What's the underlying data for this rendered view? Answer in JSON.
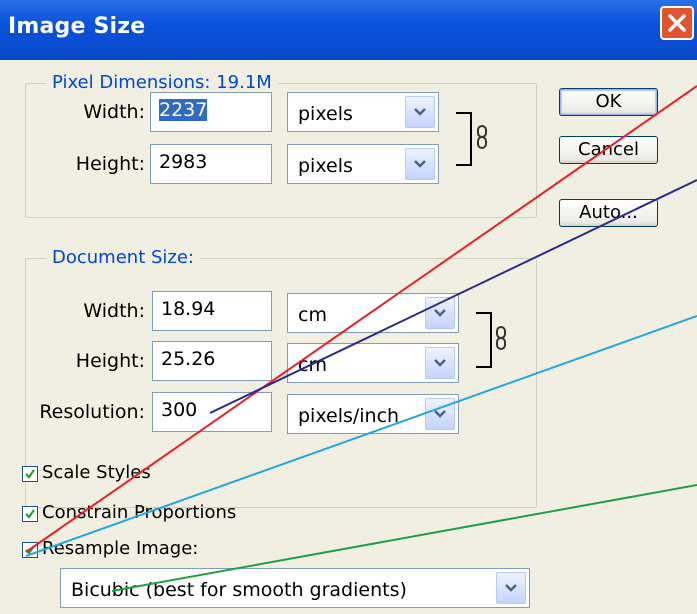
{
  "window": {
    "title": "Image Size"
  },
  "pixel_dimensions": {
    "legend": "Pixel Dimensions:  19.1M",
    "width_label": "Width:",
    "width_value": "2237",
    "width_unit": "pixels",
    "height_label": "Height:",
    "height_value": "2983",
    "height_unit": "pixels"
  },
  "document_size": {
    "legend": "Document Size:",
    "width_label": "Width:",
    "width_value": "18.94",
    "width_unit": "cm",
    "height_label": "Height:",
    "height_value": "25.26",
    "height_unit": "cm",
    "resolution_label": "Resolution:",
    "resolution_value": "300",
    "resolution_unit": "pixels/inch"
  },
  "buttons": {
    "ok": "OK",
    "cancel": "Cancel",
    "auto": "Auto..."
  },
  "options": {
    "scale_styles": {
      "label": "Scale Styles",
      "checked": true
    },
    "constrain_proportions": {
      "label": "Constrain Proportions",
      "checked": true
    },
    "resample_image": {
      "label": "Resample Image:",
      "checked": true
    }
  },
  "resample_method": "Bicubic (best for smooth gradients)",
  "annotation_colors": {
    "red": "#e8202a",
    "navy": "#2a2a8c",
    "cyan": "#22a8e0",
    "green": "#1fa046"
  }
}
